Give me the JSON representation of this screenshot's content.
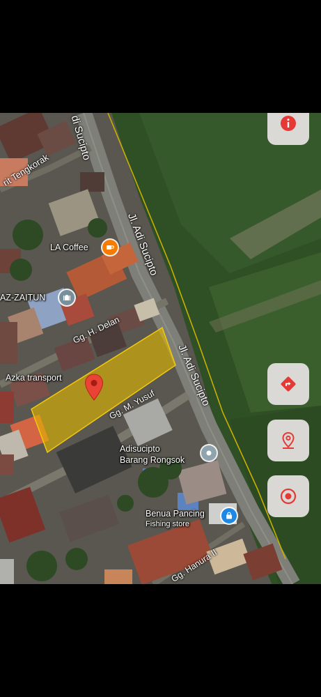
{
  "map": {
    "roads": {
      "adi_sucipto_top": "di Sucipto",
      "adi_sucipto_mid": "Jl. Adi Sucipto",
      "adi_sucipto_lower": "Jl. Adi Sucipto",
      "tengkorak": "rit Tengkorak",
      "delan": "Gg. H. Delan",
      "yusuf": "Gg. M. Yusuf",
      "hanura": "Gg. Hanura II"
    },
    "places": {
      "la_coffee": "LA Coffee",
      "az_zaitun": "AZ-ZAITUN",
      "azka_transport": "Azka transport",
      "adisucipto_line1": "Adisucipto",
      "adisucipto_line2": "Barang Rongsok",
      "benua_line1": "Benua Pancing",
      "benua_line2": "Fishing store"
    },
    "icons": {
      "coffee": "coffee-icon",
      "mosque": "mosque-icon",
      "generic_place": "place-icon",
      "shop": "shopping-bag-icon",
      "pin": "location-pin-icon"
    },
    "highlight_color": "#e2b700"
  },
  "controls": {
    "info": "info-icon",
    "directions": "directions-icon",
    "place": "place-marker-icon",
    "locate": "my-location-icon",
    "accent": "#e53935"
  }
}
